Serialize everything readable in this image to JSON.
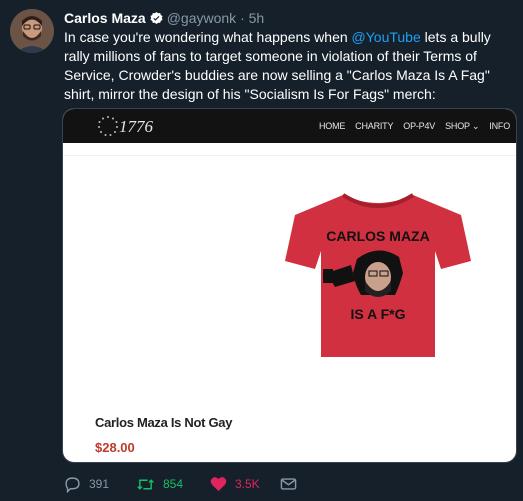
{
  "tweet": {
    "author_name": "Carlos Maza",
    "handle": "@gaywonk",
    "separator": "·",
    "time": "5h",
    "text_part1": "In case you're wondering what happens when ",
    "mention": "@YouTube",
    "text_part2": " lets a bully rally millions of fans to target someone in violation of their Terms of Service, Crowder's buddies are now selling a \"Carlos Maza Is A Fag\" shirt, mirror the design of his \"Socialism Is For Fags\" merch:"
  },
  "card": {
    "site_logo": "1776",
    "nav": [
      "HOME",
      "CHARITY",
      "OP-P4V",
      "SHOP",
      "INFO"
    ],
    "shirt_text_top": "CARLOS MAZA",
    "shirt_text_bottom": "IS A F*G",
    "product_name": "Carlos Maza Is Not Gay",
    "price": "$28.00"
  },
  "actions": {
    "replies": "391",
    "retweets": "854",
    "likes": "3.5K"
  },
  "colors": {
    "background": "#15202b",
    "link": "#1da1f2",
    "retweet": "#17bf63",
    "like": "#e0245e",
    "price": "#c0392b",
    "shirt": "#d0303f"
  }
}
